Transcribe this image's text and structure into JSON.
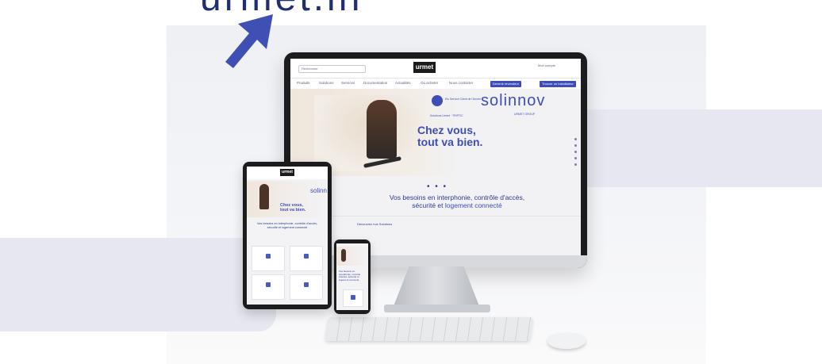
{
  "headline": {
    "partial_word": "urmet.in"
  },
  "monitor": {
    "search_placeholder": "Rechercher",
    "logo_text": "urmet",
    "account_label": "Mon compte",
    "nav": [
      "Produits",
      "Solutions",
      "Services",
      "Documentation",
      "Actualités",
      "Où acheter",
      "Nous contacter"
    ],
    "nav_buttons": [
      "Devenir revendeur",
      "Trouver un installateur"
    ],
    "badge_title": "Elu Service Client de l'Année",
    "badge_subtitle": "Solutions Urmet · TRIPTIC",
    "partner_logo": "solinnov",
    "partner_sub": "URMET GROUP",
    "slogan_line1": "Chez vous,",
    "slogan_line2": "tout va bien.",
    "carousel_dots": "• • •",
    "needs_line1": "Vos besoins en interphonie, contrôle d'accès,",
    "needs_line2_prefix": "sécurité et ",
    "needs_line2_highlight": "logement connecté",
    "small_text": "Découvrez nos Solutions"
  },
  "tablet": {
    "logo_text": "urmet",
    "partner_logo": "solinn",
    "slogan_line1": "Chez vous,",
    "slogan_line2": "tout va bien.",
    "needs_text": "Vos besoins en interphonie, contrôle d'accès, sécurité et logement connecté"
  },
  "phone": {
    "text": "Vos besoins en interphonie, contrôle d'accès, sécurité et logement connecté"
  },
  "colors": {
    "brand_blue": "#3f4db6",
    "navy": "#1f2f6f",
    "band": "#e7e7f1"
  }
}
